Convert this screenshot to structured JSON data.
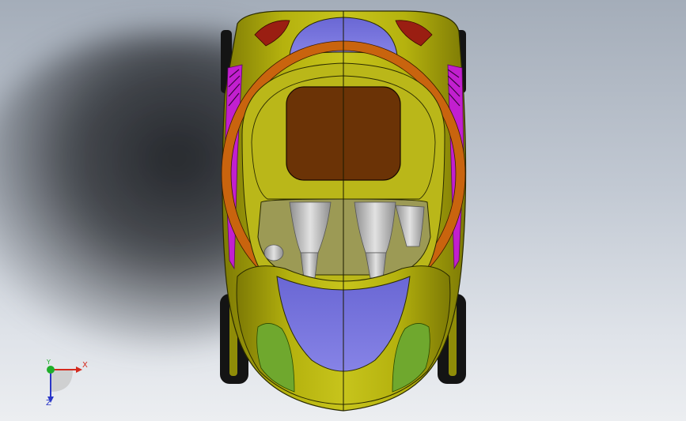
{
  "viewport": {
    "background_top": "#a4adb9",
    "background_bottom": "#eceef1"
  },
  "model": {
    "colors": {
      "body": "#b5b20e",
      "body_dark": "#8f8c08",
      "canopy_blue": "#7e7be0",
      "cabin_brown": "#6b3306",
      "ring_orange": "#c9640e",
      "accent_magenta": "#c21fcf",
      "tail_red": "#9a1e12",
      "lamp_green": "#6fa82e",
      "tire": "#141414",
      "engine_grey": "#c4c4c4"
    }
  },
  "triad": {
    "x_label": "X",
    "y_label": "Y",
    "z_label": "Z",
    "x_color": "#d42a1e",
    "y_color": "#1fae2a",
    "z_color": "#2a36c8"
  }
}
